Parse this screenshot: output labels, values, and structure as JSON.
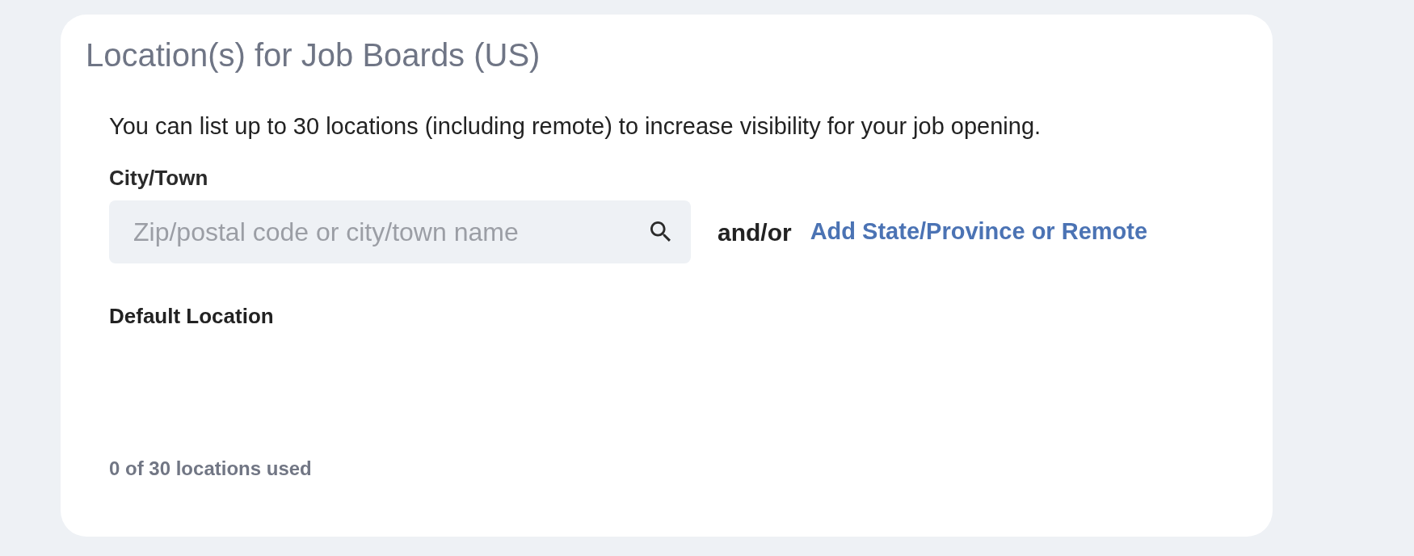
{
  "panel": {
    "title": "Location(s) for Job Boards (US)",
    "description": "You can list up to 30 locations (including remote) to increase visibility for your job opening.",
    "city_field": {
      "label": "City/Town",
      "placeholder": "Zip/postal code or city/town name"
    },
    "separator": "and/or",
    "add_link": "Add State/Province or Remote",
    "default_location": {
      "label": "Default Location"
    },
    "usage": "0 of 30 locations used"
  }
}
